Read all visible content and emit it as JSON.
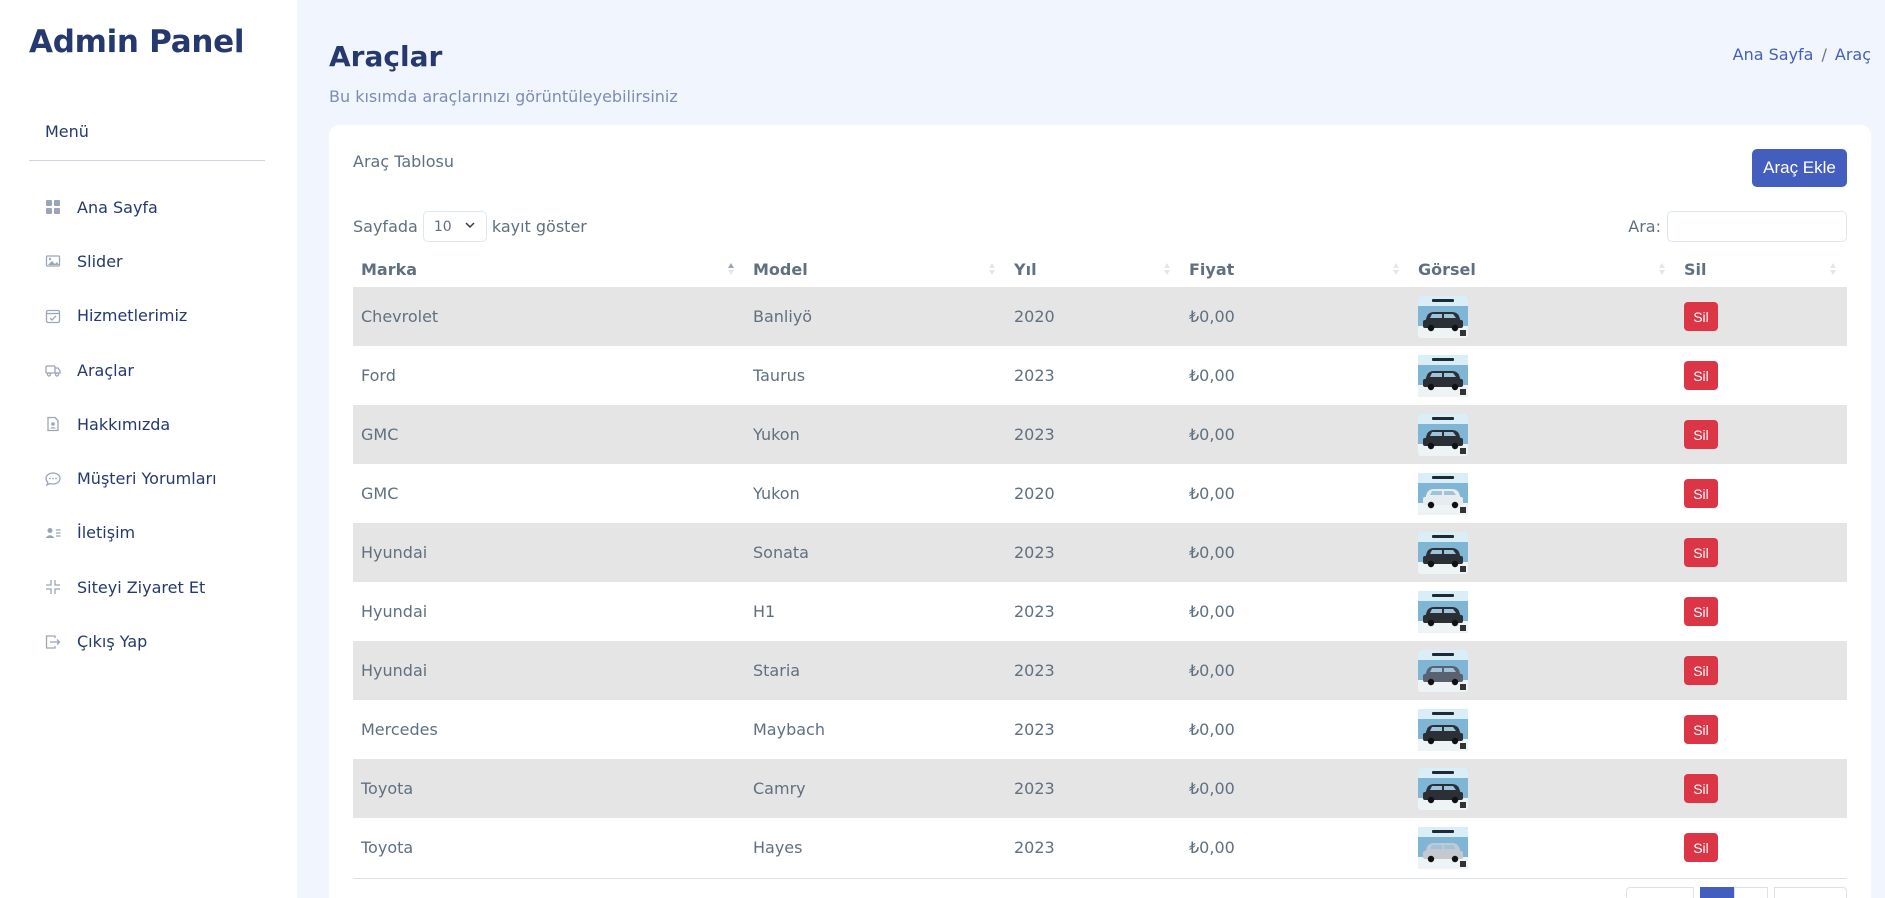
{
  "sidebar": {
    "brand": "Admin Panel",
    "menu_title": "Menü",
    "items": [
      {
        "label": "Ana Sayfa",
        "icon": "grid-icon"
      },
      {
        "label": "Slider",
        "icon": "image-icon"
      },
      {
        "label": "Hizmetlerimiz",
        "icon": "calendar-check-icon"
      },
      {
        "label": "Araçlar",
        "icon": "truck-icon"
      },
      {
        "label": "Hakkımızda",
        "icon": "document-icon"
      },
      {
        "label": "Müşteri Yorumları",
        "icon": "chat-icon"
      },
      {
        "label": "İletişim",
        "icon": "person-lines-icon"
      },
      {
        "label": "Siteyi Ziyaret Et",
        "icon": "fullscreen-exit-icon"
      },
      {
        "label": "Çıkış Yap",
        "icon": "box-arrow-right-icon"
      }
    ]
  },
  "header": {
    "title": "Araçlar",
    "subtitle": "Bu kısımda araçlarınızı görüntüleyebilirsiniz",
    "breadcrumb": {
      "home": "Ana Sayfa",
      "separator": "/",
      "current": "Araç"
    }
  },
  "card": {
    "title": "Araç Tablosu",
    "add_button": "Araç Ekle",
    "length_prefix": "Sayfada",
    "length_value": "10",
    "length_suffix": "kayıt göster",
    "search_label": "Ara:",
    "search_value": ""
  },
  "table": {
    "columns": [
      "Marka",
      "Model",
      "Yıl",
      "Fiyat",
      "Görsel",
      "Sil"
    ],
    "rows": [
      {
        "marka": "Chevrolet",
        "model": "Banliyö",
        "yil": "2020",
        "fiyat": "₺0,00",
        "sil": "Sil",
        "car_color": "dark"
      },
      {
        "marka": "Ford",
        "model": "Taurus",
        "yil": "2023",
        "fiyat": "₺0,00",
        "sil": "Sil",
        "car_color": "dark"
      },
      {
        "marka": "GMC",
        "model": "Yukon",
        "yil": "2023",
        "fiyat": "₺0,00",
        "sil": "Sil",
        "car_color": "dark"
      },
      {
        "marka": "GMC",
        "model": "Yukon",
        "yil": "2020",
        "fiyat": "₺0,00",
        "sil": "Sil",
        "car_color": "white"
      },
      {
        "marka": "Hyundai",
        "model": "Sonata",
        "yil": "2023",
        "fiyat": "₺0,00",
        "sil": "Sil",
        "car_color": "dark"
      },
      {
        "marka": "Hyundai",
        "model": "H1",
        "yil": "2023",
        "fiyat": "₺0,00",
        "sil": "Sil",
        "car_color": "dark"
      },
      {
        "marka": "Hyundai",
        "model": "Staria",
        "yil": "2023",
        "fiyat": "₺0,00",
        "sil": "Sil",
        "car_color": "grey"
      },
      {
        "marka": "Mercedes",
        "model": "Maybach",
        "yil": "2023",
        "fiyat": "₺0,00",
        "sil": "Sil",
        "car_color": "dark"
      },
      {
        "marka": "Toyota",
        "model": "Camry",
        "yil": "2023",
        "fiyat": "₺0,00",
        "sil": "Sil",
        "car_color": "dark"
      },
      {
        "marka": "Toyota",
        "model": "Hayes",
        "yil": "2023",
        "fiyat": "₺0,00",
        "sil": "Sil",
        "car_color": "silver"
      }
    ]
  },
  "colors": {
    "primary": "#435ebe",
    "danger": "#dc3545",
    "text_dark": "#25396f",
    "text_muted": "#607080",
    "stripe": "#e5e5e5",
    "background": "#f1f5fd"
  }
}
